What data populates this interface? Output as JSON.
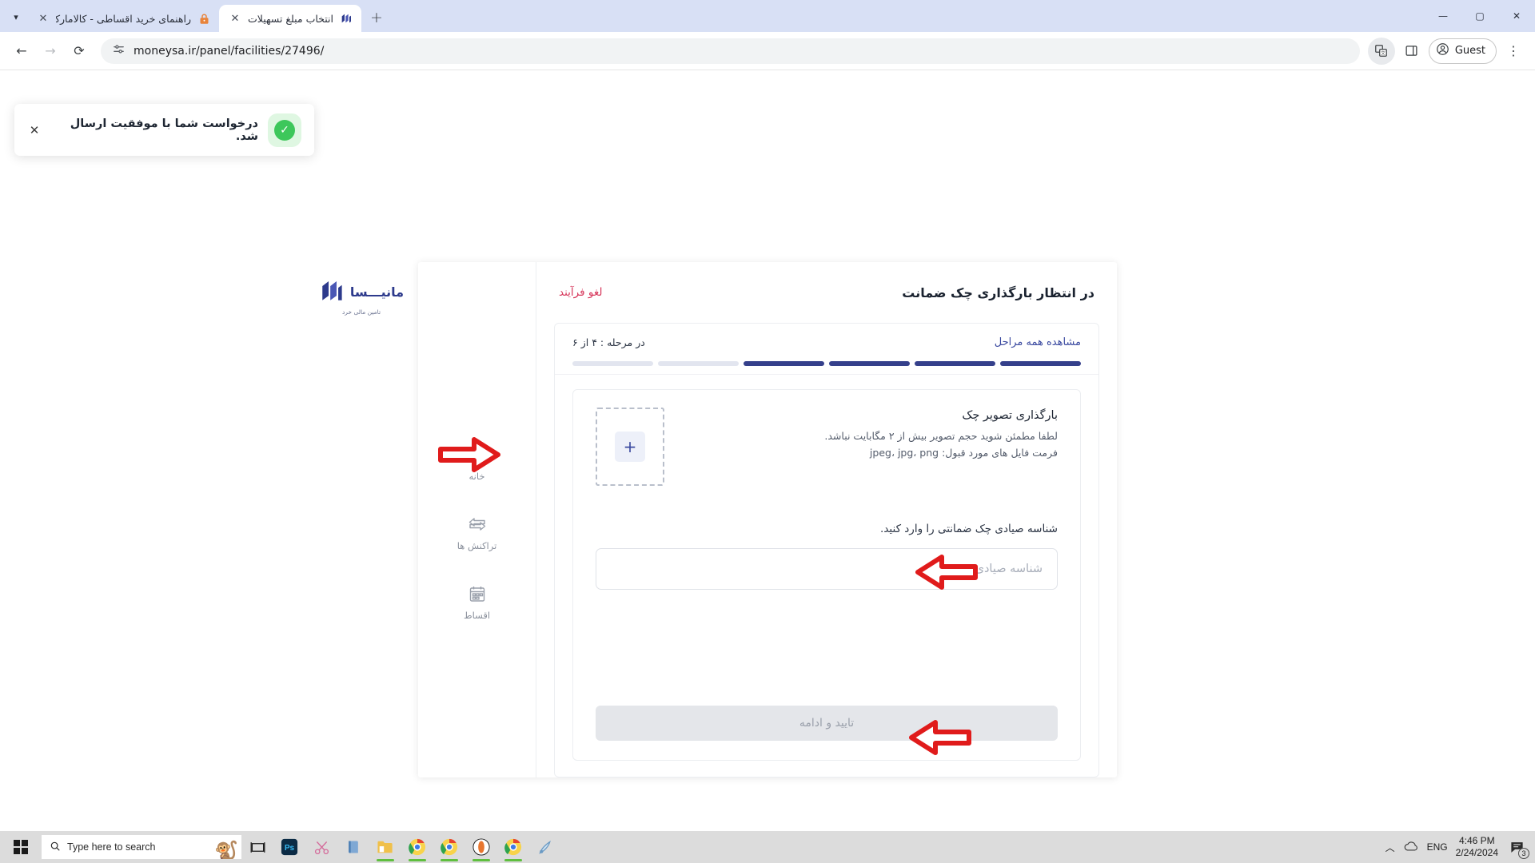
{
  "browser": {
    "tabs": [
      {
        "title": "راهنمای خرید اقساطی - کالامارکت",
        "favicon": "lock-orange-icon",
        "active": false
      },
      {
        "title": "انتخاب مبلغ تسهیلات",
        "favicon": "moneysa-logo-icon",
        "active": true
      }
    ],
    "new_tab_label": "+",
    "tab_list_chevron": "▾",
    "window_controls": {
      "minimize": "—",
      "maximize": "▢",
      "close": "✕"
    },
    "nav": {
      "back": "←",
      "forward": "→",
      "reload": "⟳"
    },
    "omnibox": {
      "url": "moneysa.ir/panel/facilities/27496/",
      "site_icon": "page-settings-icon"
    },
    "right_actions": {
      "translate": "translate-icon",
      "side_panel": "side-panel-icon",
      "profile_label": "Guest",
      "menu": "⋮"
    }
  },
  "toast": {
    "message": "درخواست شما با موفقیت ارسال شد.",
    "close": "✕",
    "status_icon": "success-check-icon",
    "accent": "#3dc75b"
  },
  "card": {
    "title": "در انتظار بارگذاری چک ضمانت",
    "cancel_label": "لغو فرآیند",
    "cancel_color": "#d6365a",
    "logo": {
      "word": "مانیـــسا",
      "subtitle": "تامین مالی خرد",
      "color": "#2d3a8c"
    }
  },
  "steps": {
    "label": "در مرحله : ۴ از ۶",
    "view_all_label": "مشاهده همه مراحل",
    "current": 4,
    "total": 6,
    "done_color": "#35408b",
    "todo_color": "#e2e5ef",
    "segments": [
      "todo",
      "todo",
      "done",
      "done",
      "done",
      "done"
    ]
  },
  "upload": {
    "title": "بارگذاری تصویر چک",
    "note_size": "لطفا مطمئن شوید حجم تصویر بیش از ۲ مگابایت نباشد.",
    "note_formats": "فرمت فایل های مورد قبول: jpeg، jpg، png",
    "plus_label": "+",
    "dropzone_name": "check-image-dropzone"
  },
  "form": {
    "field_label": "شناسه صیادی چک ضمانتی را وارد کنید.",
    "placeholder": "شناسه صیادی",
    "value": "",
    "submit_label": "تایید و ادامه",
    "submit_disabled": true
  },
  "rail": {
    "items": [
      {
        "label": "خانه",
        "icon": "home-icon"
      },
      {
        "label": "تراکنش ها",
        "icon": "transactions-arrows-icon"
      },
      {
        "label": "اقساط",
        "icon": "calendar-installments-icon"
      }
    ]
  },
  "annotations": {
    "color": "#e01b1b",
    "arrows": [
      {
        "name": "arrow-to-upload",
        "direction": "right"
      },
      {
        "name": "arrow-to-sayadi-input",
        "direction": "left"
      },
      {
        "name": "arrow-to-submit-button",
        "direction": "left"
      }
    ]
  },
  "taskbar": {
    "start_icon": "windows-start-icon",
    "search_placeholder": "Type here to search",
    "search_icon": "search-icon",
    "mascot": "monkey-image",
    "apps": [
      {
        "name": "task-view",
        "glyph": "task-view-icon",
        "running": false
      },
      {
        "name": "photoshop",
        "glyph": "Ps",
        "running": false
      },
      {
        "name": "snipping-tool",
        "glyph": "scissors-icon",
        "running": false
      },
      {
        "name": "notebook-app",
        "glyph": "notebook-icon",
        "running": false
      },
      {
        "name": "file-explorer",
        "glyph": "folder-icon",
        "running": true
      },
      {
        "name": "chrome-1",
        "glyph": "chrome-icon",
        "running": true
      },
      {
        "name": "chrome-2",
        "glyph": "chrome-icon",
        "running": true
      },
      {
        "name": "opera-browser",
        "glyph": "opera-icon",
        "running": true
      },
      {
        "name": "chrome-3",
        "glyph": "chrome-icon",
        "running": true
      },
      {
        "name": "paint",
        "glyph": "paint-icon",
        "running": false
      }
    ],
    "tray": {
      "chevron": "︿",
      "cloud_icon": "cloud-icon",
      "language": "ENG",
      "time": "4:46 PM",
      "date": "2/24/2024",
      "notification_count": "3"
    }
  }
}
